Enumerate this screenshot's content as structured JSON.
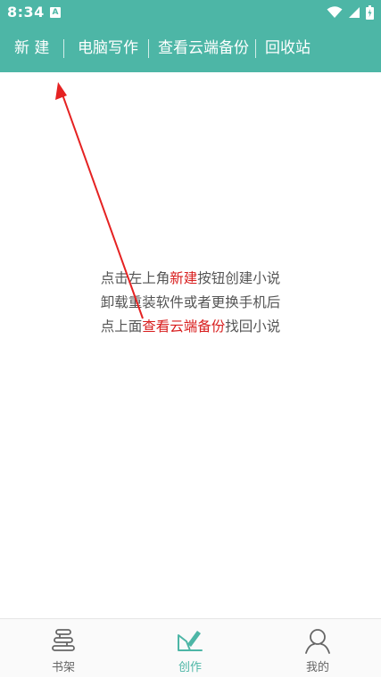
{
  "status_bar": {
    "time": "8:34",
    "notification_badge": "A",
    "icons": [
      "wifi-icon",
      "signal-icon",
      "battery-icon"
    ]
  },
  "menu": {
    "items": [
      {
        "label": "新 建",
        "icon": null
      },
      {
        "label": "电脑写作",
        "icon": null
      },
      {
        "label": "查看云端备份",
        "icon": null
      },
      {
        "label": "回收站",
        "icon": null
      }
    ]
  },
  "hint": {
    "line1_pre": "点击左上角",
    "line1_highlight": "新建",
    "line1_post": "按钮创建小说",
    "line2": "卸载重装软件或者更换手机后",
    "line3_pre": "点上面",
    "line3_highlight": "查看云端备份",
    "line3_post": "找回小说"
  },
  "bottom_nav": {
    "items": [
      {
        "label": "书架",
        "icon": "bookshelf-icon",
        "active": false
      },
      {
        "label": "创作",
        "icon": "write-icon",
        "active": true
      },
      {
        "label": "我的",
        "icon": "user-icon",
        "active": false
      }
    ]
  },
  "colors": {
    "primary": "#4db6a6",
    "highlight": "#d81e1e",
    "text": "#555555",
    "inactive": "#666666"
  }
}
